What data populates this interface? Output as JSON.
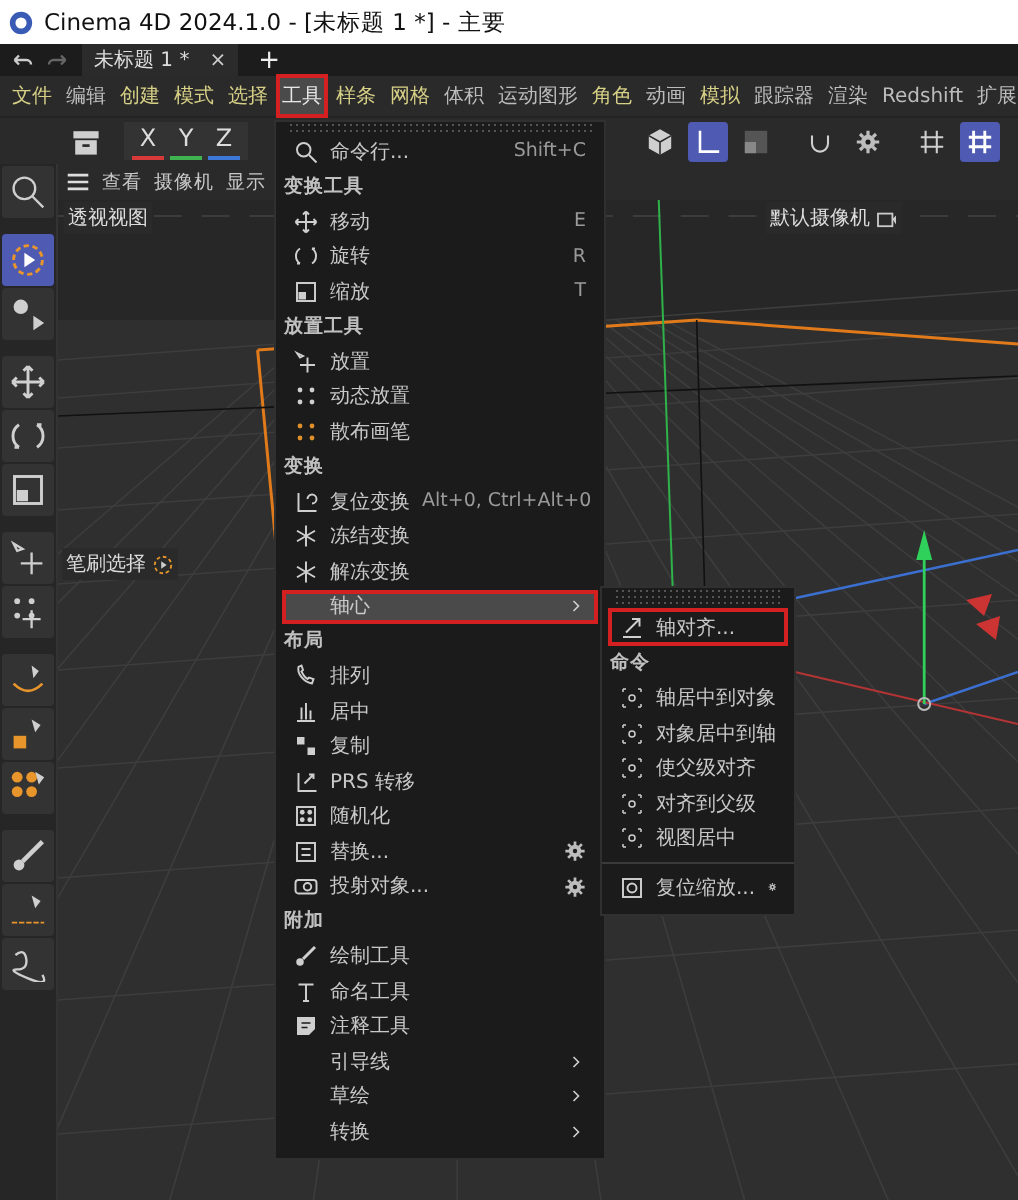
{
  "window": {
    "title": "Cinema 4D 2024.1.0 - [未标题 1 *] - 主要"
  },
  "doc_tabs": [
    {
      "label": "未标题 1 *",
      "close": "×",
      "selected": true
    }
  ],
  "new_tab": "+",
  "menu_bar": [
    {
      "label": "文件",
      "color": "#d6cf86",
      "selected": false,
      "marked": false
    },
    {
      "label": "编辑",
      "color": "#bcbcbc",
      "selected": false,
      "marked": false
    },
    {
      "label": "创建",
      "color": "#d6cf86",
      "selected": false,
      "marked": false
    },
    {
      "label": "模式",
      "color": "#d6cf86",
      "selected": false,
      "marked": false
    },
    {
      "label": "选择",
      "color": "#d6cf86",
      "selected": false,
      "marked": false
    },
    {
      "label": "工具",
      "color": "#e8e8e8",
      "selected": true,
      "marked": true
    },
    {
      "label": "样条",
      "color": "#d6cf86",
      "selected": false,
      "marked": false
    },
    {
      "label": "网格",
      "color": "#d6cf86",
      "selected": false,
      "marked": false
    },
    {
      "label": "体积",
      "color": "#bcbcbc",
      "selected": false,
      "marked": false
    },
    {
      "label": "运动图形",
      "color": "#bcbcbc",
      "selected": false,
      "marked": false
    },
    {
      "label": "角色",
      "color": "#d6cf86",
      "selected": false,
      "marked": false
    },
    {
      "label": "动画",
      "color": "#bcbcbc",
      "selected": false,
      "marked": false
    },
    {
      "label": "模拟",
      "color": "#d6cf86",
      "selected": false,
      "marked": false
    },
    {
      "label": "跟踪器",
      "color": "#bcbcbc",
      "selected": false,
      "marked": false
    },
    {
      "label": "渲染",
      "color": "#bcbcbc",
      "selected": false,
      "marked": false
    },
    {
      "label": "Redshift",
      "color": "#bcbcbc",
      "selected": false,
      "marked": false
    },
    {
      "label": "扩展",
      "color": "#bcbcbc",
      "selected": false,
      "marked": false
    }
  ],
  "toolbar": {
    "axes": [
      {
        "label": "X",
        "color": "#d83a3a"
      },
      {
        "label": "Y",
        "color": "#3fb34f"
      },
      {
        "label": "Z",
        "color": "#3b78d8"
      }
    ],
    "toggles": [
      {
        "selected": false
      },
      {
        "selected": true
      },
      {
        "selected": false
      },
      {
        "selected": false
      },
      {
        "selected": false
      },
      {
        "selected": false
      },
      {
        "selected": true
      }
    ]
  },
  "left_tools": [
    {
      "selected": false
    },
    {
      "selected": true
    },
    {
      "selected": false
    },
    {
      "selected": false
    },
    {
      "selected": false
    },
    {
      "selected": false
    },
    {
      "selected": false
    },
    {
      "selected": false
    },
    {
      "selected": false
    },
    {
      "selected": false
    },
    {
      "selected": false
    },
    {
      "selected": false
    },
    {
      "selected": false
    },
    {
      "selected": false
    }
  ],
  "viewport": {
    "menu": [
      "查看",
      "摄像机",
      "显示"
    ],
    "view_name": "透视视图",
    "camera": "默认摄像机",
    "tooltip": "笔刷选择"
  },
  "tools_menu": {
    "items": [
      {
        "kind": "item",
        "label": "命令行...",
        "shortcut": "Shift+C",
        "selected": false,
        "marked": false
      },
      {
        "kind": "section",
        "label": "变换工具"
      },
      {
        "kind": "item",
        "label": "移动",
        "shortcut": "E",
        "selected": false,
        "marked": false
      },
      {
        "kind": "item",
        "label": "旋转",
        "shortcut": "R",
        "selected": false,
        "marked": false
      },
      {
        "kind": "item",
        "label": "缩放",
        "shortcut": "T",
        "selected": false,
        "marked": false
      },
      {
        "kind": "section",
        "label": "放置工具"
      },
      {
        "kind": "item",
        "label": "放置",
        "selected": false,
        "marked": false
      },
      {
        "kind": "item",
        "label": "动态放置",
        "selected": false,
        "marked": false
      },
      {
        "kind": "item",
        "label": "散布画笔",
        "selected": false,
        "marked": false
      },
      {
        "kind": "section",
        "label": "变换"
      },
      {
        "kind": "item",
        "label": "复位变换",
        "shortcut": "Alt+0, Ctrl+Alt+0",
        "selected": false,
        "marked": false
      },
      {
        "kind": "item",
        "label": "冻结变换",
        "selected": false,
        "marked": false
      },
      {
        "kind": "item",
        "label": "解冻变换",
        "selected": false,
        "marked": false
      },
      {
        "kind": "submenu",
        "label": "轴心",
        "selected": true,
        "marked": true
      },
      {
        "kind": "section",
        "label": "布局"
      },
      {
        "kind": "item",
        "label": "排列",
        "selected": false,
        "marked": false
      },
      {
        "kind": "item",
        "label": "居中",
        "selected": false,
        "marked": false
      },
      {
        "kind": "item",
        "label": "复制",
        "selected": false,
        "marked": false
      },
      {
        "kind": "item",
        "label": "PRS 转移",
        "selected": false,
        "marked": false
      },
      {
        "kind": "item",
        "label": "随机化",
        "selected": false,
        "marked": false
      },
      {
        "kind": "item",
        "label": "替换...",
        "options": true,
        "selected": false,
        "marked": false
      },
      {
        "kind": "item",
        "label": "投射对象...",
        "options": true,
        "selected": false,
        "marked": false
      },
      {
        "kind": "section",
        "label": "附加"
      },
      {
        "kind": "item",
        "label": "绘制工具",
        "selected": false,
        "marked": false
      },
      {
        "kind": "item",
        "label": "命名工具",
        "selected": false,
        "marked": false
      },
      {
        "kind": "item",
        "label": "注释工具",
        "selected": false,
        "marked": false
      },
      {
        "kind": "submenu",
        "label": "引导线",
        "selected": false,
        "marked": false
      },
      {
        "kind": "submenu",
        "label": "草绘",
        "selected": false,
        "marked": false
      },
      {
        "kind": "submenu",
        "label": "转换",
        "selected": false,
        "marked": false
      }
    ]
  },
  "axis_submenu": {
    "items": [
      {
        "kind": "item",
        "label": "轴对齐...",
        "selected": false,
        "marked": true
      },
      {
        "kind": "section",
        "label": "命令"
      },
      {
        "kind": "item",
        "label": "轴居中到对象",
        "selected": false,
        "marked": false
      },
      {
        "kind": "item",
        "label": "对象居中到轴",
        "selected": false,
        "marked": false
      },
      {
        "kind": "item",
        "label": "使父级对齐",
        "selected": false,
        "marked": false
      },
      {
        "kind": "item",
        "label": "对齐到父级",
        "selected": false,
        "marked": false
      },
      {
        "kind": "item",
        "label": "视图居中",
        "selected": false,
        "marked": false
      },
      {
        "kind": "divider"
      },
      {
        "kind": "item",
        "label": "复位缩放...",
        "options": true,
        "selected": false,
        "marked": false
      }
    ]
  }
}
